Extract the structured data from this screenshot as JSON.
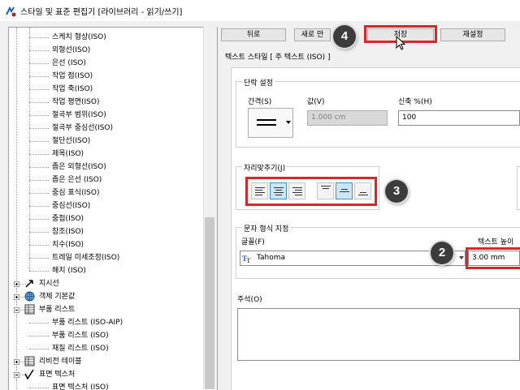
{
  "window": {
    "title": "스타일 및 표준 편집기 [라이브러리 - 읽기/쓰기]",
    "app_icon": "style-editor-icon"
  },
  "tree": {
    "items": [
      {
        "label": "스케치 형상(ISO)",
        "indent": 2
      },
      {
        "label": "외형선(ISO)",
        "indent": 2
      },
      {
        "label": "은선 (ISO)",
        "indent": 2
      },
      {
        "label": "작업 점(ISO)",
        "indent": 2
      },
      {
        "label": "작업 축(ISO)",
        "indent": 2
      },
      {
        "label": "작업 평면(ISO)",
        "indent": 2
      },
      {
        "label": "절곡부 범위(ISO)",
        "indent": 2
      },
      {
        "label": "절곡부 중심선(ISO)",
        "indent": 2
      },
      {
        "label": "절단선(ISO)",
        "indent": 2
      },
      {
        "label": "제목(ISO)",
        "indent": 2
      },
      {
        "label": "좁은 외형선(ISO)",
        "indent": 2
      },
      {
        "label": "좁은 은선 (ISO)",
        "indent": 2
      },
      {
        "label": "중심 표식(ISO)",
        "indent": 2
      },
      {
        "label": "중심선(ISO)",
        "indent": 2
      },
      {
        "label": "중첩(ISO)",
        "indent": 2
      },
      {
        "label": "참조(ISO)",
        "indent": 2
      },
      {
        "label": "치수(ISO)",
        "indent": 2
      },
      {
        "label": "트레일 미세조정(ISO)",
        "indent": 2
      },
      {
        "label": "해치 (ISO)",
        "indent": 2
      },
      {
        "label": "지시선",
        "indent": 1,
        "expander": "plus",
        "icon": "leader-icon"
      },
      {
        "label": "객체 기본값",
        "indent": 1,
        "expander": "plus",
        "icon": "globe-icon"
      },
      {
        "label": "부품 리스트",
        "indent": 1,
        "expander": "minus",
        "icon": "parts-list-icon"
      },
      {
        "label": "부품 리스트 (ISO-AIP)",
        "indent": 2
      },
      {
        "label": "부품 리스트 (ISO)",
        "indent": 2
      },
      {
        "label": "재질 리스트 (ISO)",
        "indent": 2
      },
      {
        "label": "리비전 테이블",
        "indent": 1,
        "expander": "plus",
        "icon": "table-icon"
      },
      {
        "label": "표면 텍스처",
        "indent": 1,
        "expander": "minus",
        "icon": "surface-texture-icon"
      },
      {
        "label": "표면 텍스처 (ISO)",
        "indent": 2
      }
    ]
  },
  "toolbar": {
    "back_label": "뒤로",
    "new_label": "새로 만",
    "save_label": "저장",
    "reset_label": "재설정"
  },
  "caption": "텍스트 스타일 [ 주 텍스트 (ISO) ]",
  "paragraph": {
    "group_label": "단락 설정",
    "spacing_label": "간격(S)",
    "value_label": "값(V)",
    "value_field": "1.000 cm",
    "stretch_label": "신축 %(H)",
    "stretch_field": "100"
  },
  "justification": {
    "group_label": "자리맞추기(J)"
  },
  "char_format": {
    "group_label": "문자 형식 지정",
    "font_label": "글꼴(F)",
    "font_value": "Tahoma",
    "font_icon": "truetype-icon",
    "text_height_label": "텍스트 높이",
    "text_height_value": "3.00 mm"
  },
  "comment": {
    "label": "주석(O)"
  },
  "callouts": {
    "step_2": "2",
    "step_3": "3",
    "step_4": "4"
  },
  "colors": {
    "highlight_red": "#d9262c",
    "badge": "#3c3c3c",
    "active_blue": "#cde6f7"
  }
}
